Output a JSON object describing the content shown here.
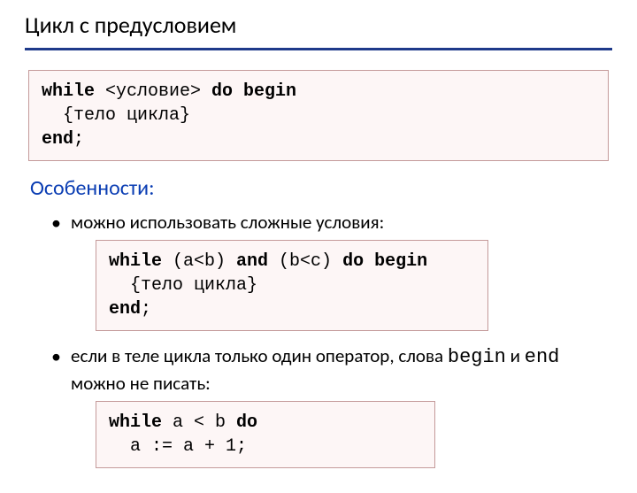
{
  "title": "Цикл с предусловием",
  "codeboxes": {
    "syntax": "while <условие> do begin\n  {тело цикла}\nend;",
    "example1": "while (a<b) and (b<c) do begin\n  {тело цикла}\nend;",
    "example2": "while a < b do\n  a := a + 1;"
  },
  "subheading": "Особенности:",
  "bullets": {
    "b1": "можно использовать сложные условия:",
    "b2_pre": "если в теле цикла только один оператор, слова ",
    "b2_code1": "begin",
    "b2_mid": " и ",
    "b2_code2": "end",
    "b2_post": " можно не писать:"
  }
}
